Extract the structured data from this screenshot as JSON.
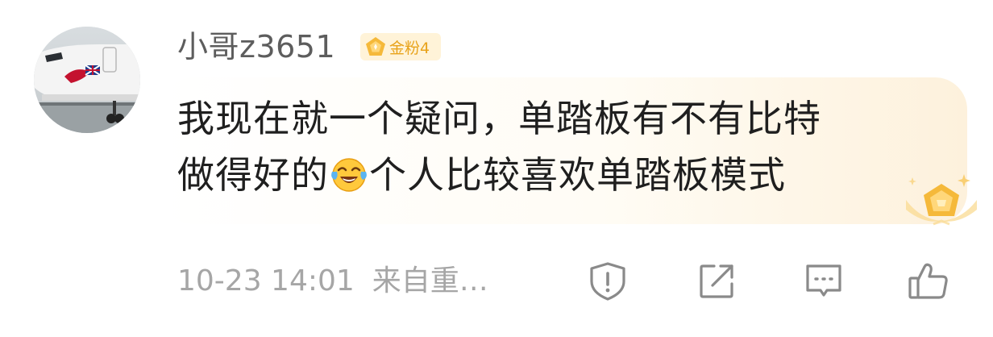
{
  "user": {
    "name": "小哥z3651",
    "badge_label": "金粉4",
    "badge_color": "#e8a31b",
    "badge_icon": "gold-pentagon-icon"
  },
  "comment": {
    "line1": "我现在就一个疑问，单踏板有不有比特",
    "line2_before": "做得好的",
    "emoji": "laughing-crying-emoji",
    "line2_after": "个人比较喜欢单踏板模式"
  },
  "meta": {
    "timestamp": "10-23 14:01",
    "source": "来自重…"
  },
  "actions": {
    "report_icon": "shield-exclamation-icon",
    "share_icon": "share-arrow-icon",
    "comment_icon": "comment-bubble-icon",
    "like_icon": "thumbs-up-icon"
  },
  "colors": {
    "text_primary": "#1f1f1f",
    "username": "#5d5d5d",
    "meta": "#a6a6a6",
    "icon": "#8a8a8a",
    "gold": "#f5b93a"
  }
}
